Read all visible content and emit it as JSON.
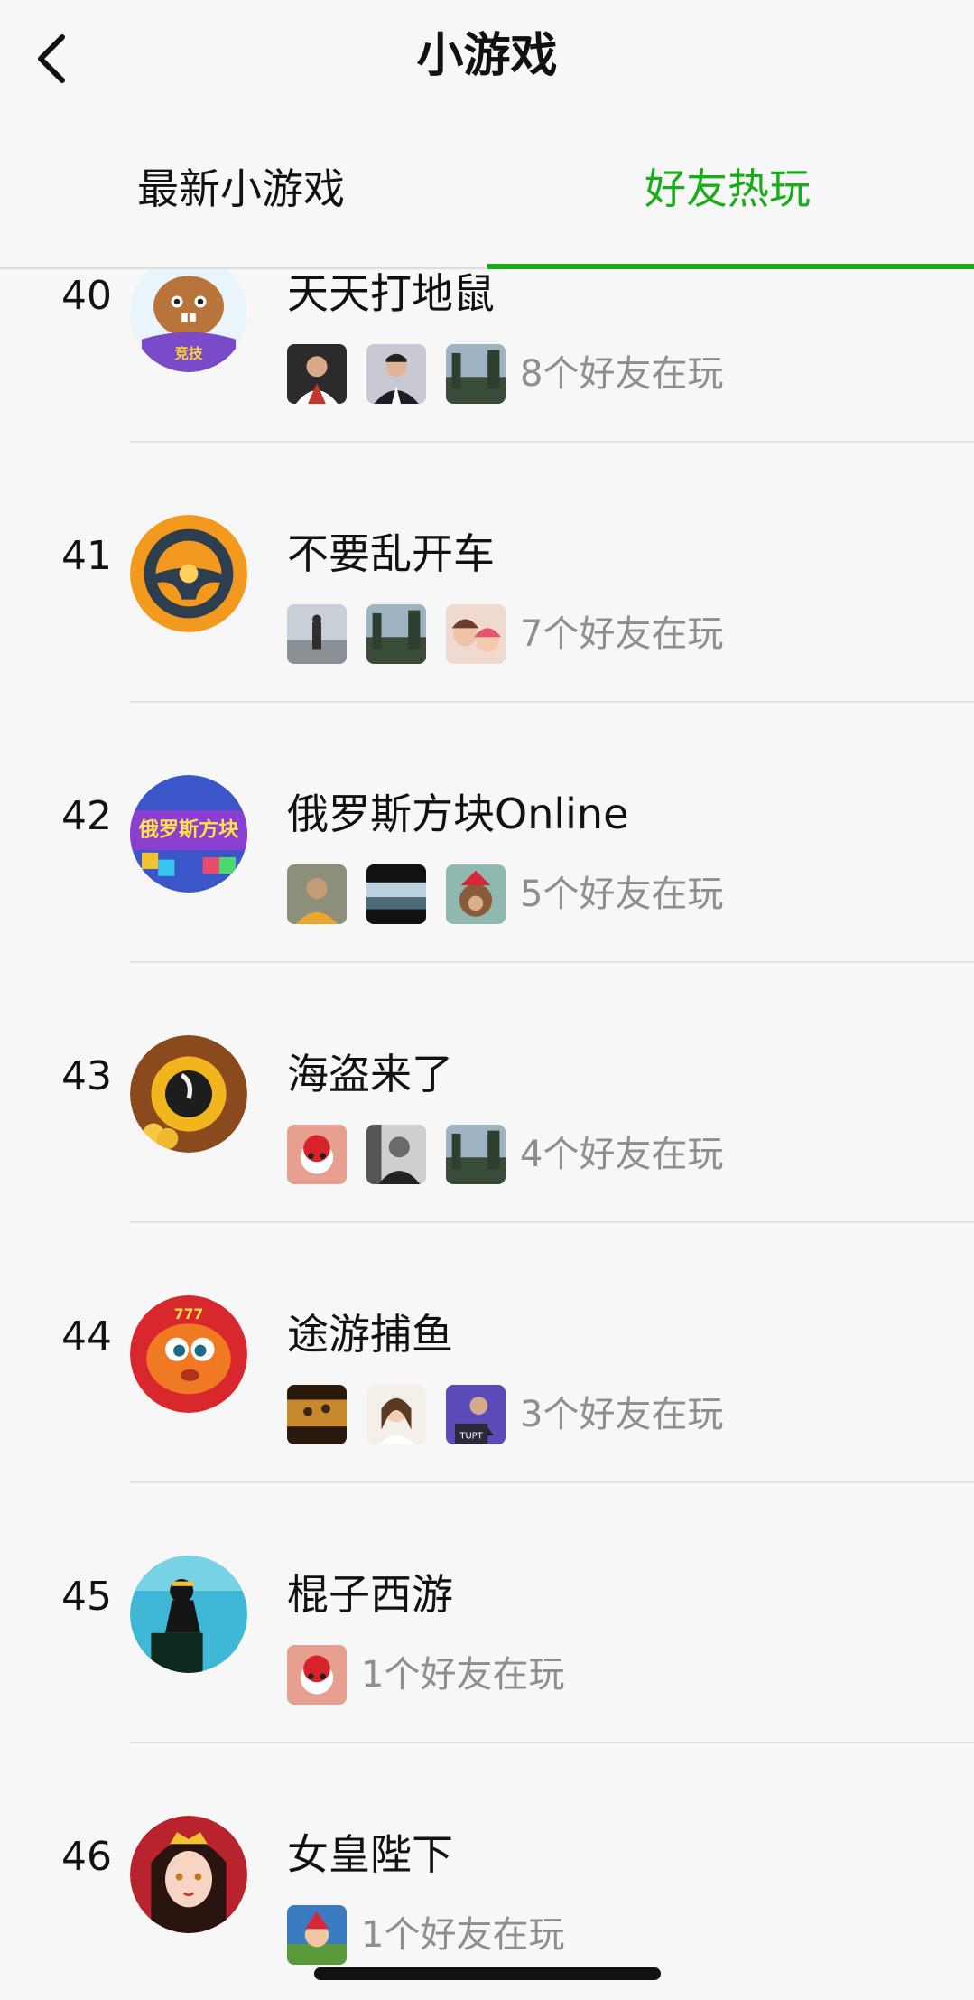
{
  "header": {
    "title": "小游戏",
    "back_icon": "chevron-left-icon"
  },
  "tabs": [
    {
      "label": "最新小游戏",
      "active": false
    },
    {
      "label": "好友热玩",
      "active": true
    }
  ],
  "accent_color": "#1aad19",
  "games": [
    {
      "rank": "40",
      "title": "天天打地鼠",
      "icon": "mole-badge-icon",
      "friends_text": "8个好友在玩",
      "avatars": 3
    },
    {
      "rank": "41",
      "title": "不要乱开车",
      "icon": "steering-wheel-icon",
      "friends_text": "7个好友在玩",
      "avatars": 3
    },
    {
      "rank": "42",
      "title": "俄罗斯方块Online",
      "icon": "tetris-online-icon",
      "friends_text": "5个好友在玩",
      "avatars": 3
    },
    {
      "rank": "43",
      "title": "海盗来了",
      "icon": "pirate-cannon-icon",
      "friends_text": "4个好友在玩",
      "avatars": 3
    },
    {
      "rank": "44",
      "title": "途游捕鱼",
      "icon": "fish-icon",
      "friends_text": "3个好友在玩",
      "avatars": 3
    },
    {
      "rank": "45",
      "title": "棍子西游",
      "icon": "stick-hero-icon",
      "friends_text": "1个好友在玩",
      "avatars": 1
    },
    {
      "rank": "46",
      "title": "女皇陛下",
      "icon": "empress-icon",
      "friends_text": "1个好友在玩",
      "avatars": 1
    }
  ]
}
